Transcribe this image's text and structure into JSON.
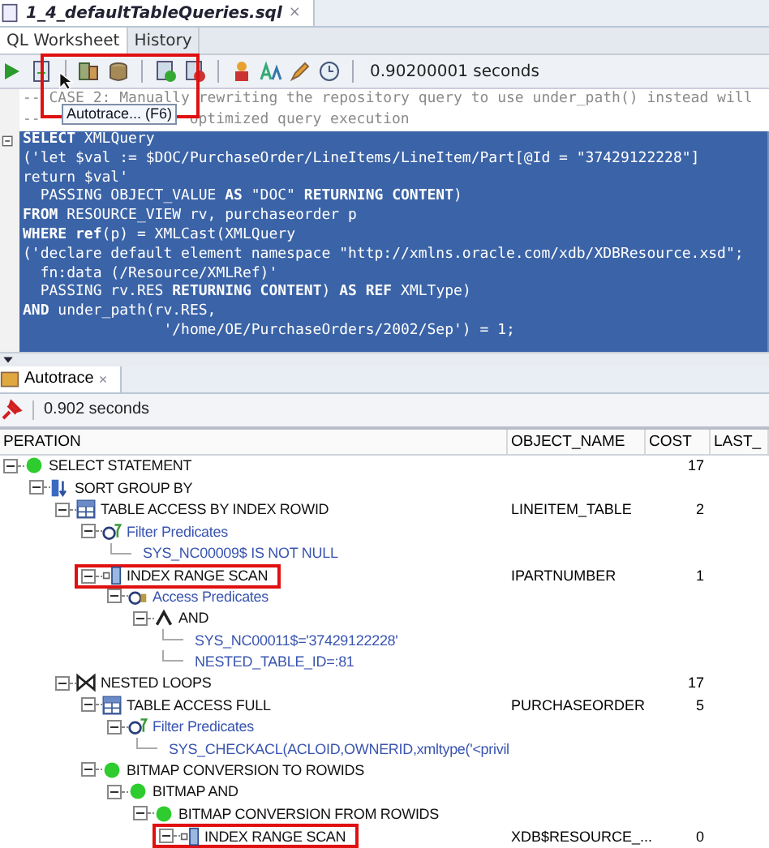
{
  "editor_tab": {
    "title": "1_4_defaultTableQueries.sql",
    "close": "×"
  },
  "sub_tabs": [
    {
      "label": "QL Worksheet",
      "selected": true
    },
    {
      "label": "History",
      "selected": false
    }
  ],
  "toolbar": {
    "timing": "0.90200001 seconds",
    "highlighted": true
  },
  "tooltip": "Autotrace... (F6)",
  "comments": [
    [
      "-- CASE 2: Manually rewriting the repository query to use under_path() instead will"
    ],
    [
      "--",
      "optimized query execution"
    ]
  ],
  "code": {
    "selected": true,
    "lines": [
      "**SELECT** XMLQuery",
      "('let $val := $DOC/PurchaseOrder/LineItems/LineItem/Part[@Id = \"37429122228\"]",
      "return $val'",
      "  PASSING OBJECT_VALUE **AS** \"DOC\" **RETURNING CONTENT**)",
      "**FROM** RESOURCE_VIEW rv, purchaseorder p",
      "**WHERE** **ref**(p) = XMLCast(XMLQuery",
      "('declare default element namespace \"http://xmlns.oracle.com/xdb/XDBResource.xsd\";",
      "  fn:data (/Resource/XMLRef)'",
      "  PASSING rv.RES **RETURNING CONTENT**) **AS REF** XMLType)",
      "**AND** under_path(rv.RES,",
      "                '/home/OE/PurchaseOrders/2002/Sep') = 1;"
    ]
  },
  "trace_tab": {
    "title": "Autotrace",
    "close": "×"
  },
  "trace_toolbar": {
    "timing": "0.902 seconds"
  },
  "plan": {
    "columns": [
      "PERATION",
      "OBJECT_NAME",
      "COST",
      "LAST_"
    ],
    "rows": [
      {
        "kind": "status",
        "label": "SELECT STATEMENT",
        "cost": "17",
        "expanded": true,
        "highlighted": false,
        "children": [
          {
            "kind": "sort",
            "label": "SORT GROUP BY",
            "expanded": true,
            "highlighted": false,
            "children": [
              {
                "kind": "table",
                "label": "TABLE ACCESS BY INDEX ROWID",
                "object_name": "LINEITEM_TABLE",
                "cost": "2",
                "expanded": true,
                "highlighted": false,
                "children": [
                  {
                    "kind": "filter",
                    "label": "Filter Predicates",
                    "expanded": true,
                    "highlighted": false,
                    "children": [
                      {
                        "kind": "value",
                        "label": "SYS_NC00009$ IS NOT NULL",
                        "highlighted": false
                      }
                    ]
                  },
                  {
                    "kind": "index",
                    "label": "INDEX RANGE SCAN",
                    "object_name": "IPARTNUMBER",
                    "cost": "1",
                    "expanded": true,
                    "highlighted": true,
                    "children": [
                      {
                        "kind": "access",
                        "label": "Access Predicates",
                        "expanded": true,
                        "highlighted": false,
                        "children": [
                          {
                            "kind": "and",
                            "label": "AND",
                            "expanded": true,
                            "highlighted": false,
                            "children": [
                              {
                                "kind": "value",
                                "label": "SYS_NC00011$='37429122228'",
                                "highlighted": false
                              },
                              {
                                "kind": "value",
                                "label": "NESTED_TABLE_ID=:81",
                                "highlighted": false
                              }
                            ]
                          }
                        ]
                      }
                    ]
                  }
                ]
              },
              {
                "kind": "loops",
                "label": "NESTED LOOPS",
                "cost": "17",
                "expanded": true,
                "highlighted": false,
                "children": [
                  {
                    "kind": "table",
                    "label": "TABLE ACCESS FULL",
                    "object_name": "PURCHASEORDER",
                    "cost": "5",
                    "expanded": true,
                    "highlighted": false,
                    "children": [
                      {
                        "kind": "filter",
                        "label": "Filter Predicates",
                        "expanded": true,
                        "highlighted": false,
                        "children": [
                          {
                            "kind": "value",
                            "label": "SYS_CHECKACL(ACLOID,OWNERID,xmltype('<privil",
                            "highlighted": false
                          }
                        ]
                      }
                    ]
                  },
                  {
                    "kind": "status",
                    "label": "BITMAP CONVERSION TO ROWIDS",
                    "expanded": true,
                    "highlighted": false,
                    "children": [
                      {
                        "kind": "status",
                        "label": "BITMAP AND",
                        "expanded": true,
                        "highlighted": false,
                        "children": [
                          {
                            "kind": "status",
                            "label": "BITMAP CONVERSION FROM ROWIDS",
                            "expanded": true,
                            "highlighted": false,
                            "children": [
                              {
                                "kind": "index",
                                "label": "INDEX RANGE SCAN",
                                "object_name": "XDB$RESOURCE_...",
                                "cost": "0",
                                "expanded": true,
                                "highlighted": true
                              }
                            ]
                          }
                        ]
                      }
                    ]
                  }
                ]
              }
            ]
          }
        ]
      }
    ]
  }
}
